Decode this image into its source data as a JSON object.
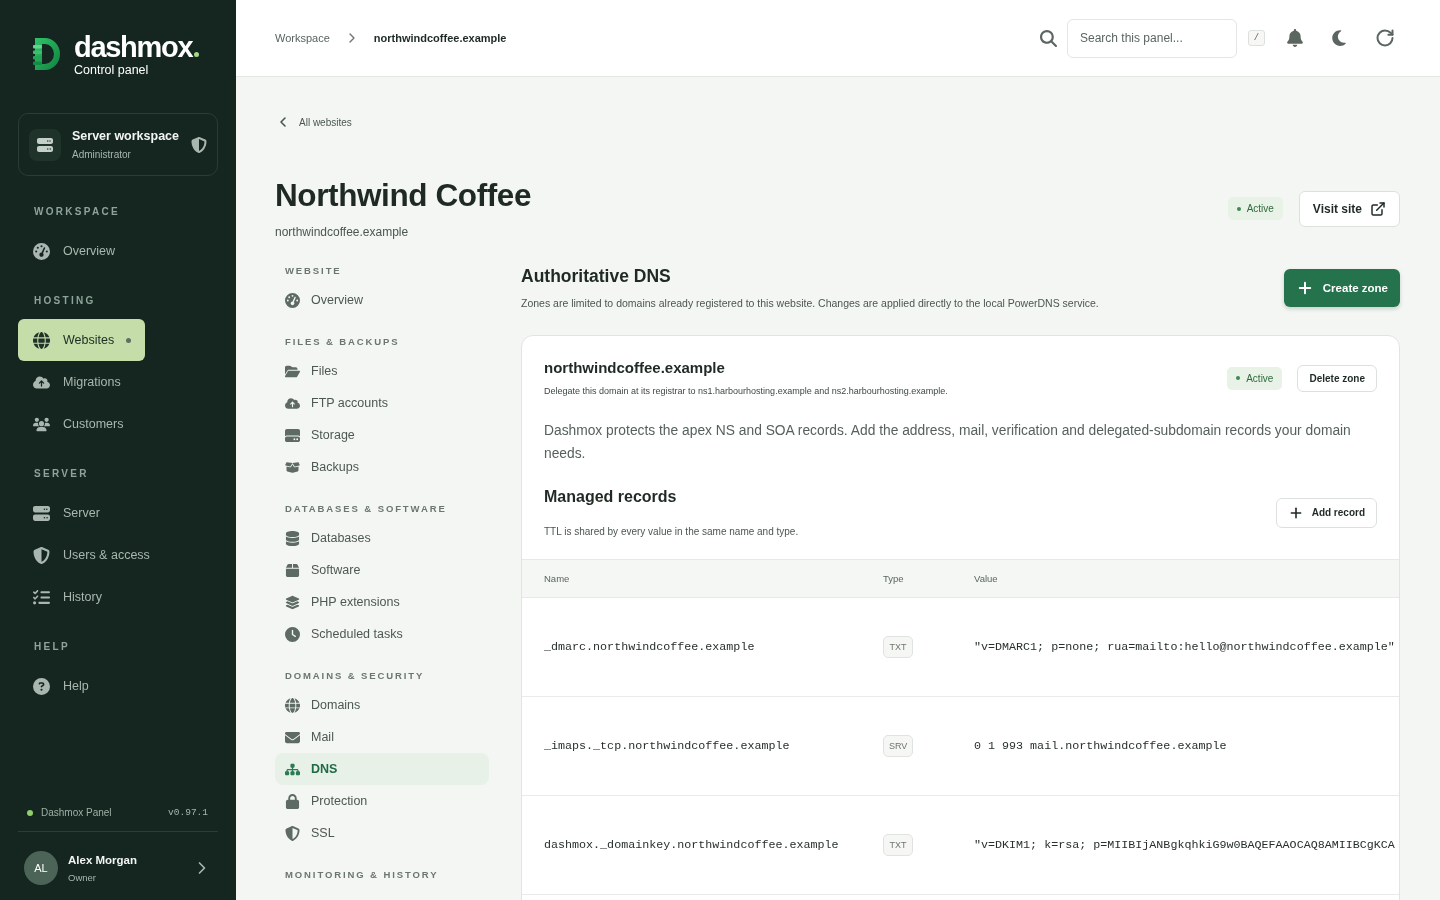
{
  "sidebar": {
    "logo": {
      "name": "dashmox",
      "tagline": "Control panel"
    },
    "workspace": {
      "title": "Server workspace",
      "role": "Administrator"
    },
    "sections": [
      {
        "label": "WORKSPACE",
        "items": [
          {
            "label": "Overview",
            "selected": false
          }
        ]
      },
      {
        "label": "HOSTING",
        "items": [
          {
            "label": "Websites",
            "selected": true
          },
          {
            "label": "Migrations",
            "selected": false
          },
          {
            "label": "Customers",
            "selected": false
          }
        ]
      },
      {
        "label": "SERVER",
        "items": [
          {
            "label": "Server",
            "selected": false
          },
          {
            "label": "Users & access",
            "selected": false
          },
          {
            "label": "History",
            "selected": false
          }
        ]
      },
      {
        "label": "HELP",
        "items": [
          {
            "label": "Help",
            "selected": false
          }
        ]
      }
    ],
    "status": {
      "label": "Dashmox Panel",
      "online": true,
      "version": "v0.97.1"
    },
    "user": {
      "initials": "AL",
      "name": "Alex Morgan",
      "role": "Owner"
    }
  },
  "header": {
    "breadcrumbs": [
      "Workspace",
      "northwindcoffee.example"
    ],
    "search": {
      "placeholder": "Search this panel..."
    },
    "shortcut": "/"
  },
  "page": {
    "back_link": "All websites",
    "title": "Northwind Coffee",
    "domain": "northwindcoffee.example",
    "status": "Active",
    "visit_button": "Visit site"
  },
  "subnav": {
    "sections": [
      {
        "label": "WEBSITE",
        "items": [
          {
            "label": "Overview",
            "selected": false
          }
        ]
      },
      {
        "label": "FILES & BACKUPS",
        "items": [
          {
            "label": "Files",
            "selected": false
          },
          {
            "label": "FTP accounts",
            "selected": false
          },
          {
            "label": "Storage",
            "selected": false
          },
          {
            "label": "Backups",
            "selected": false
          }
        ]
      },
      {
        "label": "DATABASES & SOFTWARE",
        "items": [
          {
            "label": "Databases",
            "selected": false
          },
          {
            "label": "Software",
            "selected": false
          },
          {
            "label": "PHP extensions",
            "selected": false
          },
          {
            "label": "Scheduled tasks",
            "selected": false
          }
        ]
      },
      {
        "label": "DOMAINS & SECURITY",
        "items": [
          {
            "label": "Domains",
            "selected": false
          },
          {
            "label": "Mail",
            "selected": false
          },
          {
            "label": "DNS",
            "selected": true
          },
          {
            "label": "Protection",
            "selected": false
          },
          {
            "label": "SSL",
            "selected": false
          }
        ]
      },
      {
        "label": "MONITORING & HISTORY"
      }
    ]
  },
  "dns": {
    "title": "Authoritative DNS",
    "description": "Zones are limited to domains already registered to this website. Changes are applied directly to the local PowerDNS service.",
    "create_button": "Create zone",
    "zone": {
      "name": "northwindcoffee.example",
      "delegation": "Delegate this domain at its registrar to ns1.harbourhosting.example and ns2.harbourhosting.example.",
      "status": "Active",
      "delete_button": "Delete zone",
      "note": "Dashmox protects the apex NS and SOA records. Add the address, mail, verification and delegated-subdomain records your domain needs.",
      "records_title": "Managed records",
      "records_hint": "TTL is shared by every value in the same name and type.",
      "add_button": "Add record",
      "table": {
        "columns": [
          "Name",
          "Type",
          "Value"
        ],
        "rows": [
          {
            "name": "_dmarc.northwindcoffee.example",
            "type": "TXT",
            "value": "\"v=DMARC1; p=none; rua=mailto:hello@northwindcoffee.example\""
          },
          {
            "name": "_imaps._tcp.northwindcoffee.example",
            "type": "SRV",
            "value": "0 1 993 mail.northwindcoffee.example"
          },
          {
            "name": "dashmox._domainkey.northwindcoffee.example",
            "type": "TXT",
            "value": "\"v=DKIM1; k=rsa; p=MIIBIjANBgkqhkiG9w0BAQEFAAOCAQ8AMIIBCgKCA"
          }
        ]
      }
    }
  }
}
